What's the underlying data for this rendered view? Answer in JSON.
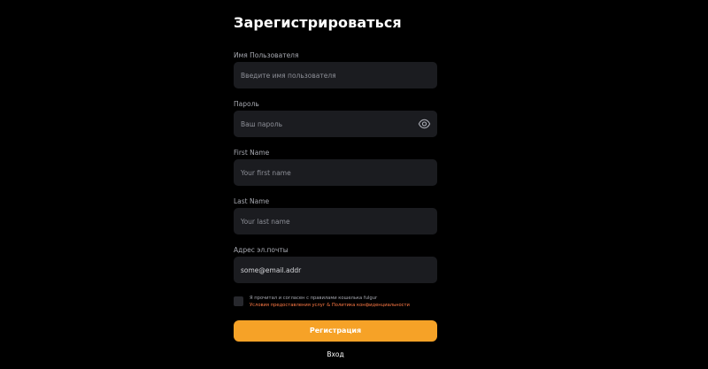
{
  "title": "Зарегистрироваться",
  "fields": {
    "username": {
      "label": "Имя Пользователя",
      "placeholder": "Введите имя пользователя",
      "value": ""
    },
    "password": {
      "label": "Пароль",
      "placeholder": "Ваш пароль",
      "value": ""
    },
    "first_name": {
      "label": "First Name",
      "placeholder": "Your first name",
      "value": ""
    },
    "last_name": {
      "label": "Last Name",
      "placeholder": "Your last name",
      "value": ""
    },
    "email": {
      "label": "Адрес эл.почты",
      "placeholder": "",
      "value": "some@email.addr"
    }
  },
  "agreement": {
    "text": "Я прочитал и согласен с правилами кошелька fulgur",
    "terms_link": "Условия предоставления услуг",
    "separator": " & ",
    "privacy_link": "Политика конфиденциальности",
    "checked": false
  },
  "submit_label": "Регистрация",
  "login_label": "Вход",
  "colors": {
    "background": "#000000",
    "input_bg": "#1b1c20",
    "accent": "#f6a227",
    "link": "#ff7a45"
  },
  "icons": {
    "password_toggle": "eye-icon"
  }
}
